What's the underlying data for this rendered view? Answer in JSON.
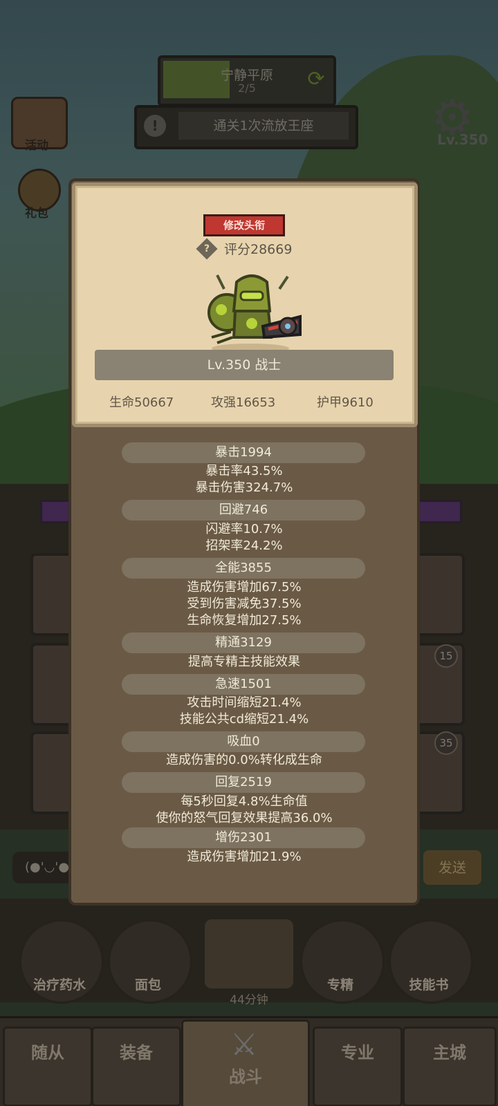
{
  "hud": {
    "zone_name": "宁静平原",
    "zone_progress": "2/5",
    "quest": "通关1次流放王座",
    "level_tag": "Lv.350",
    "side_left_1": "活动",
    "side_left_2": "礼包"
  },
  "background": {
    "chat_hint": "(●'◡'●",
    "send_label": "发送",
    "badges": [
      "15",
      "35"
    ]
  },
  "quick_items": [
    {
      "label": "治疗药水"
    },
    {
      "label": "面包"
    },
    {
      "label": "专精"
    },
    {
      "label": "技能书"
    }
  ],
  "timer": "44分钟",
  "tabs": [
    "随从",
    "装备",
    "战斗",
    "专业",
    "主城"
  ],
  "profile": {
    "rename_button": "修改头衔",
    "score": "评分28669",
    "title": "Lv.350 战士",
    "hp": "生命50667",
    "attack": "攻强16653",
    "armor": "护甲9610"
  },
  "stats": [
    {
      "head": "暴击1994",
      "lines": [
        "暴击率43.5%",
        "暴击伤害324.7%"
      ]
    },
    {
      "head": "回避746",
      "lines": [
        "闪避率10.7%",
        "招架率24.2%"
      ]
    },
    {
      "head": "全能3855",
      "lines": [
        "造成伤害增加67.5%",
        "受到伤害减免37.5%",
        "生命恢复增加27.5%"
      ]
    },
    {
      "head": "精通3129",
      "lines": [
        "提高专精主技能效果"
      ]
    },
    {
      "head": "急速1501",
      "lines": [
        "攻击时间缩短21.4%",
        "技能公共cd缩短21.4%"
      ]
    },
    {
      "head": "吸血0",
      "lines": [
        "造成伤害的0.0%转化成生命"
      ]
    },
    {
      "head": "回复2519",
      "lines": [
        "每5秒回复4.8%生命值",
        "使你的怒气回复效果提高36.0%"
      ]
    },
    {
      "head": "增伤2301",
      "lines": [
        "造成伤害增加21.9%"
      ]
    }
  ]
}
